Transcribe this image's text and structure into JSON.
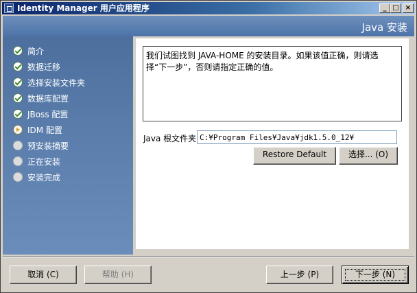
{
  "window": {
    "title": "Identity Manager 用户应用程序",
    "controls": {
      "minimize": "_",
      "maximize": "□",
      "close": "×"
    }
  },
  "header": {
    "title": "Java 安装"
  },
  "sidebar": {
    "steps": [
      {
        "label": "简介",
        "status": "done"
      },
      {
        "label": "数据迁移",
        "status": "done"
      },
      {
        "label": "选择安装文件夹",
        "status": "done"
      },
      {
        "label": "数据库配置",
        "status": "done"
      },
      {
        "label": "JBoss 配置",
        "status": "done"
      },
      {
        "label": "IDM 配置",
        "status": "current"
      },
      {
        "label": "预安装摘要",
        "status": "pending"
      },
      {
        "label": "正在安装",
        "status": "pending"
      },
      {
        "label": "安装完成",
        "status": "pending"
      }
    ]
  },
  "main": {
    "info_text": "我们试图找到 JAVA-HOME 的安装目录。如果该值正确，则请选择“下一步”，否则请指定正确的值。",
    "java_folder_label": "Java 根文件夹",
    "java_folder_value": "C:¥Program Files¥Java¥jdk1.5.0_12¥",
    "restore_default_label": "Restore Default",
    "choose_label": "选择... (O)"
  },
  "footer": {
    "cancel_label": "取消 (C)",
    "help_label": "帮助 (H)",
    "prev_label": "上一步 (P)",
    "next_label": "下一步 (N)"
  },
  "colors": {
    "titlebar": "#0a246a",
    "sidebar": "#5c7fae",
    "header": "#5a7fb3",
    "done_check": "#3d8a2e",
    "current_arrow": "#d9a31e"
  },
  "icons": {
    "done": "check-circle-icon",
    "current": "arrow-circle-icon",
    "pending": "empty-circle-icon"
  }
}
